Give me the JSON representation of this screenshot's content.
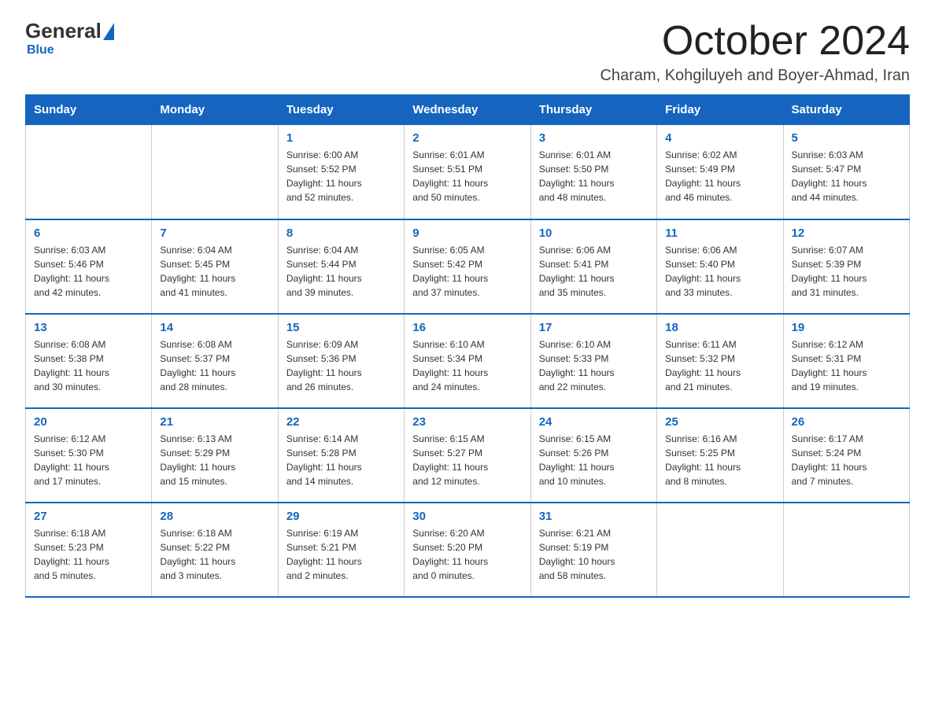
{
  "logo": {
    "general": "General",
    "blue": "Blue"
  },
  "title": "October 2024",
  "location": "Charam, Kohgiluyeh and Boyer-Ahmad, Iran",
  "weekdays": [
    "Sunday",
    "Monday",
    "Tuesday",
    "Wednesday",
    "Thursday",
    "Friday",
    "Saturday"
  ],
  "weeks": [
    [
      {
        "day": "",
        "info": ""
      },
      {
        "day": "",
        "info": ""
      },
      {
        "day": "1",
        "info": "Sunrise: 6:00 AM\nSunset: 5:52 PM\nDaylight: 11 hours\nand 52 minutes."
      },
      {
        "day": "2",
        "info": "Sunrise: 6:01 AM\nSunset: 5:51 PM\nDaylight: 11 hours\nand 50 minutes."
      },
      {
        "day": "3",
        "info": "Sunrise: 6:01 AM\nSunset: 5:50 PM\nDaylight: 11 hours\nand 48 minutes."
      },
      {
        "day": "4",
        "info": "Sunrise: 6:02 AM\nSunset: 5:49 PM\nDaylight: 11 hours\nand 46 minutes."
      },
      {
        "day": "5",
        "info": "Sunrise: 6:03 AM\nSunset: 5:47 PM\nDaylight: 11 hours\nand 44 minutes."
      }
    ],
    [
      {
        "day": "6",
        "info": "Sunrise: 6:03 AM\nSunset: 5:46 PM\nDaylight: 11 hours\nand 42 minutes."
      },
      {
        "day": "7",
        "info": "Sunrise: 6:04 AM\nSunset: 5:45 PM\nDaylight: 11 hours\nand 41 minutes."
      },
      {
        "day": "8",
        "info": "Sunrise: 6:04 AM\nSunset: 5:44 PM\nDaylight: 11 hours\nand 39 minutes."
      },
      {
        "day": "9",
        "info": "Sunrise: 6:05 AM\nSunset: 5:42 PM\nDaylight: 11 hours\nand 37 minutes."
      },
      {
        "day": "10",
        "info": "Sunrise: 6:06 AM\nSunset: 5:41 PM\nDaylight: 11 hours\nand 35 minutes."
      },
      {
        "day": "11",
        "info": "Sunrise: 6:06 AM\nSunset: 5:40 PM\nDaylight: 11 hours\nand 33 minutes."
      },
      {
        "day": "12",
        "info": "Sunrise: 6:07 AM\nSunset: 5:39 PM\nDaylight: 11 hours\nand 31 minutes."
      }
    ],
    [
      {
        "day": "13",
        "info": "Sunrise: 6:08 AM\nSunset: 5:38 PM\nDaylight: 11 hours\nand 30 minutes."
      },
      {
        "day": "14",
        "info": "Sunrise: 6:08 AM\nSunset: 5:37 PM\nDaylight: 11 hours\nand 28 minutes."
      },
      {
        "day": "15",
        "info": "Sunrise: 6:09 AM\nSunset: 5:36 PM\nDaylight: 11 hours\nand 26 minutes."
      },
      {
        "day": "16",
        "info": "Sunrise: 6:10 AM\nSunset: 5:34 PM\nDaylight: 11 hours\nand 24 minutes."
      },
      {
        "day": "17",
        "info": "Sunrise: 6:10 AM\nSunset: 5:33 PM\nDaylight: 11 hours\nand 22 minutes."
      },
      {
        "day": "18",
        "info": "Sunrise: 6:11 AM\nSunset: 5:32 PM\nDaylight: 11 hours\nand 21 minutes."
      },
      {
        "day": "19",
        "info": "Sunrise: 6:12 AM\nSunset: 5:31 PM\nDaylight: 11 hours\nand 19 minutes."
      }
    ],
    [
      {
        "day": "20",
        "info": "Sunrise: 6:12 AM\nSunset: 5:30 PM\nDaylight: 11 hours\nand 17 minutes."
      },
      {
        "day": "21",
        "info": "Sunrise: 6:13 AM\nSunset: 5:29 PM\nDaylight: 11 hours\nand 15 minutes."
      },
      {
        "day": "22",
        "info": "Sunrise: 6:14 AM\nSunset: 5:28 PM\nDaylight: 11 hours\nand 14 minutes."
      },
      {
        "day": "23",
        "info": "Sunrise: 6:15 AM\nSunset: 5:27 PM\nDaylight: 11 hours\nand 12 minutes."
      },
      {
        "day": "24",
        "info": "Sunrise: 6:15 AM\nSunset: 5:26 PM\nDaylight: 11 hours\nand 10 minutes."
      },
      {
        "day": "25",
        "info": "Sunrise: 6:16 AM\nSunset: 5:25 PM\nDaylight: 11 hours\nand 8 minutes."
      },
      {
        "day": "26",
        "info": "Sunrise: 6:17 AM\nSunset: 5:24 PM\nDaylight: 11 hours\nand 7 minutes."
      }
    ],
    [
      {
        "day": "27",
        "info": "Sunrise: 6:18 AM\nSunset: 5:23 PM\nDaylight: 11 hours\nand 5 minutes."
      },
      {
        "day": "28",
        "info": "Sunrise: 6:18 AM\nSunset: 5:22 PM\nDaylight: 11 hours\nand 3 minutes."
      },
      {
        "day": "29",
        "info": "Sunrise: 6:19 AM\nSunset: 5:21 PM\nDaylight: 11 hours\nand 2 minutes."
      },
      {
        "day": "30",
        "info": "Sunrise: 6:20 AM\nSunset: 5:20 PM\nDaylight: 11 hours\nand 0 minutes."
      },
      {
        "day": "31",
        "info": "Sunrise: 6:21 AM\nSunset: 5:19 PM\nDaylight: 10 hours\nand 58 minutes."
      },
      {
        "day": "",
        "info": ""
      },
      {
        "day": "",
        "info": ""
      }
    ]
  ]
}
